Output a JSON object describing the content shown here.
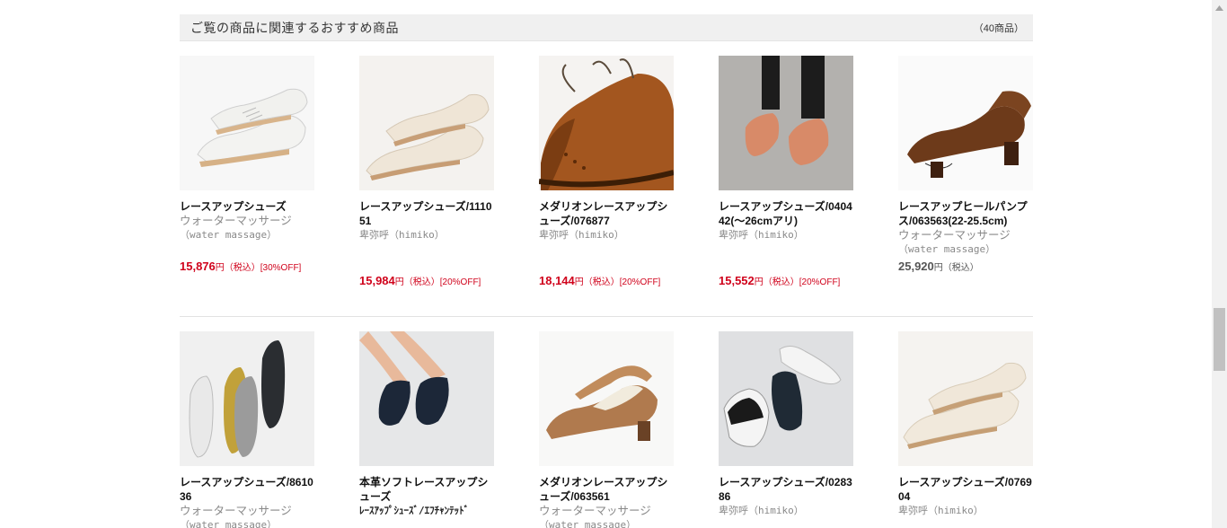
{
  "section": {
    "title": "ご覧の商品に関連するおすすめ商品",
    "count": "（40商品）"
  },
  "row1": [
    {
      "name": "レースアップシューズ",
      "brand": "ウォーターマッサージ",
      "brand_sub": "（water massage）",
      "price": "15,876",
      "yen": "円",
      "tax": "（税込）",
      "off": "[30%OFF]",
      "sale": true
    },
    {
      "name": "レースアップシューズ/111051",
      "brand": "",
      "brand_sub": "卑弥呼（himiko）",
      "price": "15,984",
      "yen": "円",
      "tax": "（税込）",
      "off": "[20%OFF]",
      "sale": true
    },
    {
      "name": "メダリオンレースアップシューズ/076877",
      "brand": "",
      "brand_sub": "卑弥呼（himiko）",
      "price": "18,144",
      "yen": "円",
      "tax": "（税込）",
      "off": "[20%OFF]",
      "sale": true
    },
    {
      "name": "レースアップシューズ/040442(～26cmアリ)",
      "brand": "",
      "brand_sub": "卑弥呼（himiko）",
      "price": "15,552",
      "yen": "円",
      "tax": "（税込）",
      "off": "[20%OFF]",
      "sale": true
    },
    {
      "name": "レースアップヒールパンプス/063563(22-25.5cm)",
      "brand": "ウォーターマッサージ",
      "brand_sub": "（water massage）",
      "price": "25,920",
      "yen": "円",
      "tax": "（税込）",
      "off": "",
      "sale": false
    }
  ],
  "row2": [
    {
      "name": "レースアップシューズ/861036",
      "brand": "ウォーターマッサージ",
      "brand_sub": "（water massage）"
    },
    {
      "name": "本革ソフトレースアップシューズ",
      "brand": "",
      "brand_sub": "ﾚｰｽｱｯﾌﾟｼｭｰｽﾞ/ｴﾌﾁｬﾝﾃｯﾄﾞ"
    },
    {
      "name": "メダリオンレースアップシューズ/063561",
      "brand": "ウォーターマッサージ",
      "brand_sub": "（water massage）"
    },
    {
      "name": "レースアップシューズ/028386",
      "brand": "",
      "brand_sub": "卑弥呼（himiko）"
    },
    {
      "name": "レースアップシューズ/076904",
      "brand": "",
      "brand_sub": "卑弥呼（himiko）"
    }
  ],
  "colors": {
    "sale_price": "#d0021b",
    "header_bg": "#f0f0f0",
    "brand_text": "#888888"
  },
  "icons": {
    "thumb_1_1": "white-oxford-shoes-image",
    "thumb_1_2": "cream-oxford-shoes-image",
    "thumb_1_3": "brown-brogue-closeup-image",
    "thumb_1_4": "pink-oxford-worn-image",
    "thumb_1_5": "brown-wingtip-heel-image",
    "thumb_2_1": "multicolor-oxfords-image",
    "thumb_2_2": "navy-oxford-worn-image",
    "thumb_2_3": "two-tone-brogue-heel-image",
    "thumb_2_4": "black-white-spectator-image",
    "thumb_2_5": "ivory-wingtip-image"
  }
}
